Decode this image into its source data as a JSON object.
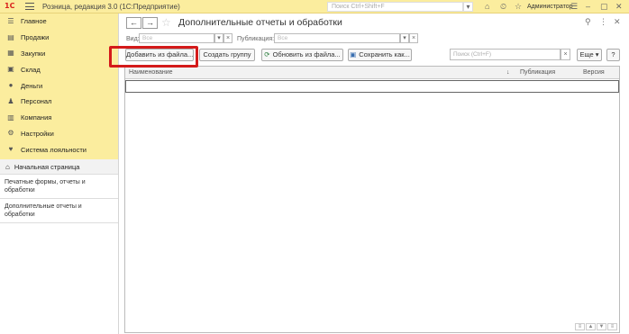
{
  "titlebar": {
    "logo": "1С",
    "app_title": "Розница, редакция 3.0  (1С:Предприятие)",
    "search_placeholder": "Поиск Ctrl+Shift+F",
    "user_name": "Администратор"
  },
  "sidebar": {
    "items": [
      {
        "label": "Главное",
        "icon": "list-icon"
      },
      {
        "label": "Продажи",
        "icon": "sales-icon"
      },
      {
        "label": "Закупки",
        "icon": "purchases-icon"
      },
      {
        "label": "Склад",
        "icon": "warehouse-icon"
      },
      {
        "label": "Деньги",
        "icon": "money-icon"
      },
      {
        "label": "Персонал",
        "icon": "person-icon"
      },
      {
        "label": "Компания",
        "icon": "company-icon"
      },
      {
        "label": "Настройки",
        "icon": "settings-icon"
      },
      {
        "label": "Система лояльности",
        "icon": "heart-icon"
      }
    ],
    "start_page": "Начальная страница",
    "open_windows": [
      "Печатные формы, отчеты и обработки",
      "Дополнительные отчеты и обработки"
    ]
  },
  "main": {
    "title": "Дополнительные отчеты и обработки",
    "filters": {
      "kind_label": "Вид:",
      "kind_placeholder": "Все",
      "publication_label": "Публикация:",
      "publication_placeholder": "Все"
    },
    "toolbar": {
      "add_from_file": "Добавить из файла...",
      "create_group": "Создать группу",
      "update_from_file": "Обновить из файла...",
      "save_as": "Сохранить как...",
      "search_placeholder": "Поиск (Ctrl+F)",
      "more": "Еще",
      "help": "?"
    },
    "table": {
      "columns": [
        "Наименование",
        "Публикация",
        "Версия"
      ],
      "rows": []
    }
  },
  "colors": {
    "sidebar_bg": "#fbed9e",
    "highlight": "#d41a1a",
    "brand": "#d9211c"
  }
}
